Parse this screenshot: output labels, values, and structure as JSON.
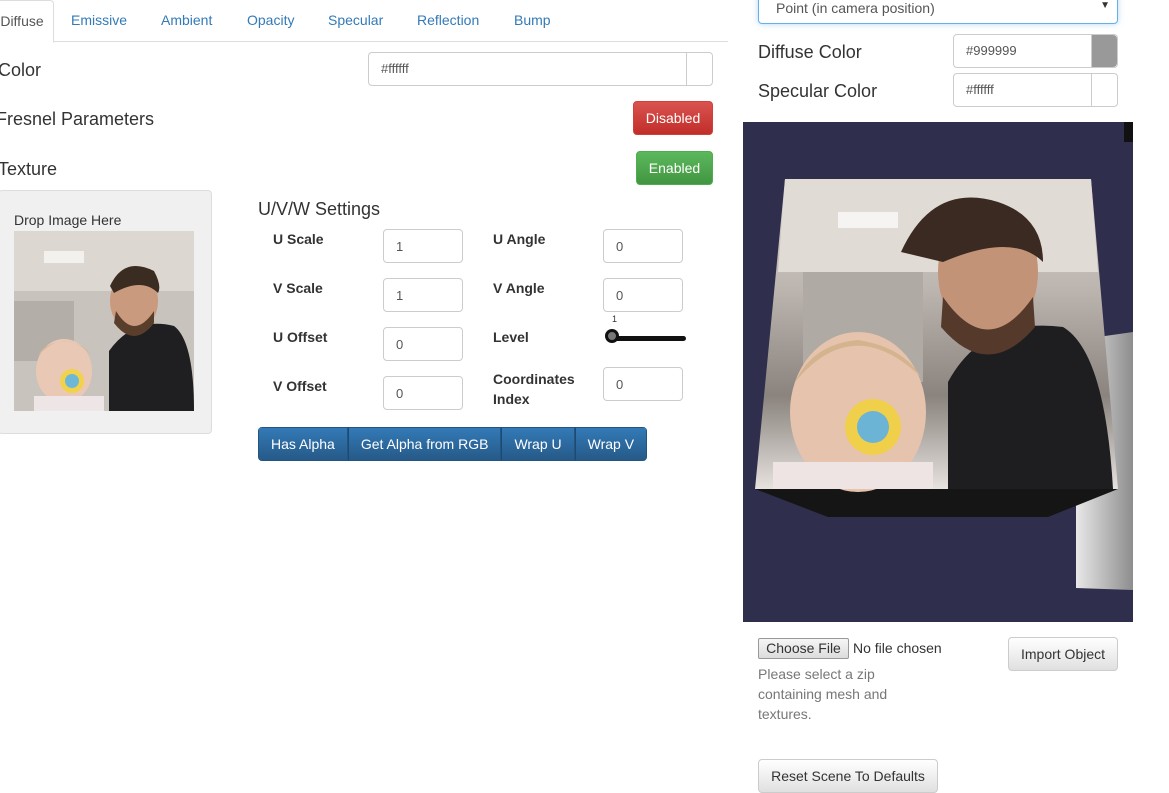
{
  "tabs": [
    {
      "label": "Diffuse",
      "active": true
    },
    {
      "label": "Emissive"
    },
    {
      "label": "Ambient"
    },
    {
      "label": "Opacity"
    },
    {
      "label": "Specular"
    },
    {
      "label": "Reflection"
    },
    {
      "label": "Bump"
    }
  ],
  "color": {
    "label": "Color",
    "value": "#ffffff",
    "swatch": "#ffffff"
  },
  "fresnel": {
    "label": "Fresnel Parameters",
    "button": "Disabled"
  },
  "texture": {
    "label": "Texture",
    "button": "Enabled"
  },
  "drop_label": "Drop Image Here",
  "uvw": {
    "title": "U/V/W Settings",
    "u_scale": {
      "label": "U Scale",
      "value": "1"
    },
    "v_scale": {
      "label": "V Scale",
      "value": "1"
    },
    "u_offset": {
      "label": "U Offset",
      "value": "0"
    },
    "v_offset": {
      "label": "V Offset",
      "value": "0"
    },
    "u_angle": {
      "label": "U Angle",
      "value": "0"
    },
    "v_angle": {
      "label": "V Angle",
      "value": "0"
    },
    "level": {
      "label": "Level",
      "value": "1",
      "fraction": 0
    },
    "coords_index": {
      "label_line1": "Coordinates",
      "label_line2": "Index",
      "value": "0"
    }
  },
  "toggles": [
    "Has Alpha",
    "Get Alpha from RGB",
    "Wrap U",
    "Wrap V"
  ],
  "light": {
    "select_value": "Point (in camera position)",
    "diffuse_label": "Diffuse Color",
    "diffuse_value": "#999999",
    "diffuse_swatch": "#999999",
    "specular_label": "Specular Color",
    "specular_value": "#ffffff",
    "specular_swatch": "#ffffff"
  },
  "import": {
    "choose_file": "Choose File",
    "no_file": "No file chosen",
    "hint_line1": "Please select a zip",
    "hint_line2": "containing mesh and",
    "hint_line3": "textures.",
    "import_button": "Import Object"
  },
  "reset_button": "Reset Scene To Defaults",
  "colors": {
    "link": "#337ab7",
    "scene_bg": "#2f2e4d",
    "danger": "#d9534f",
    "success": "#5cb85c",
    "primary": "#337ab7"
  }
}
